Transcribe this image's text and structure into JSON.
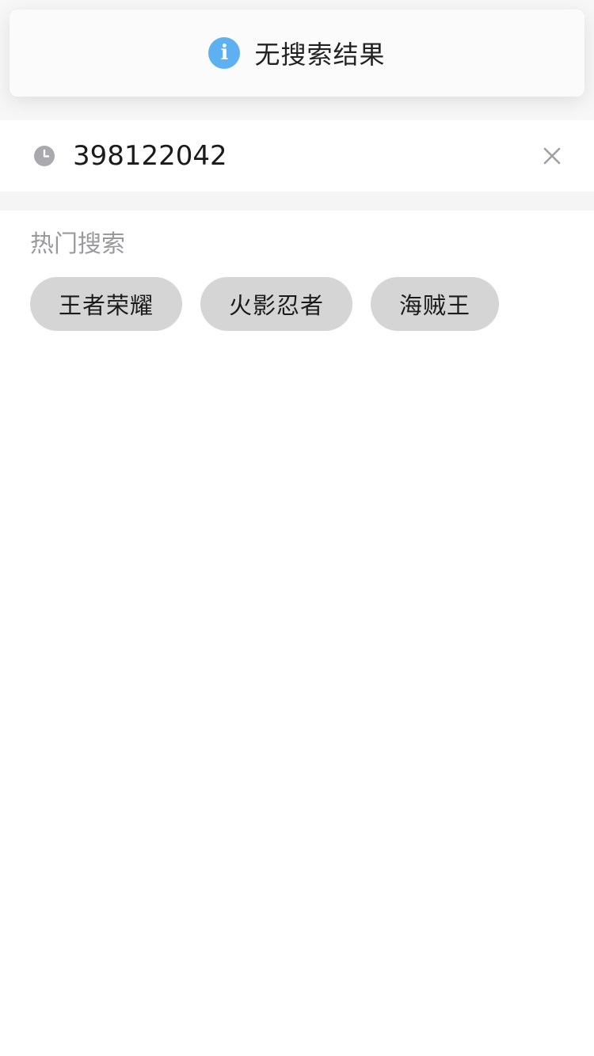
{
  "toast": {
    "icon": "info-icon",
    "icon_glyph": "i",
    "message": "无搜索结果",
    "icon_color": "#5db1f1"
  },
  "search": {
    "history_icon": "clock-icon",
    "value": "398122042",
    "clear_icon": "close-icon"
  },
  "hot": {
    "title": "热门搜索",
    "tags": [
      {
        "label": "王者荣耀"
      },
      {
        "label": "火影忍者"
      },
      {
        "label": "海贼王"
      }
    ],
    "tag_bg": "#d5d5d5"
  }
}
